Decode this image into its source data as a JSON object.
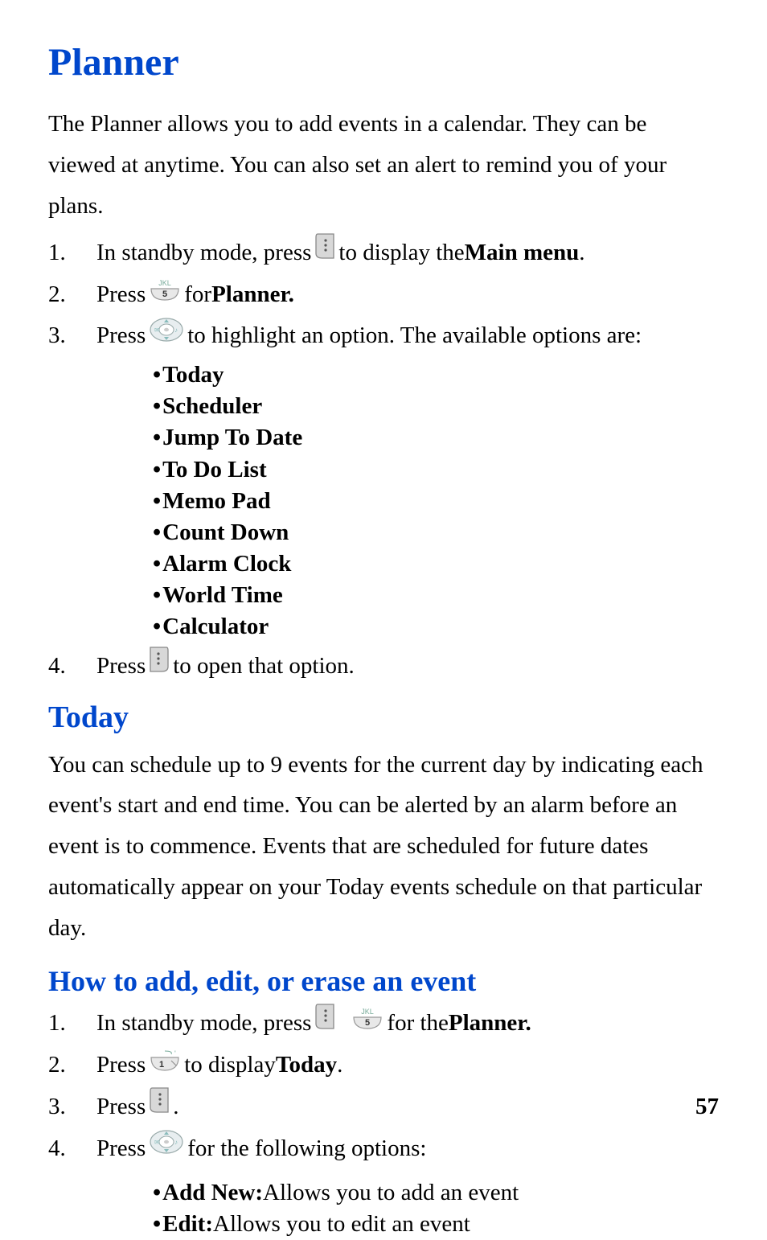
{
  "title": "Planner",
  "intro": "The Planner allows you to add events in a calendar. They can be viewed at anytime. You can also set an alert to remind you of your plans.",
  "steps1": {
    "s1a": "In standby mode, press ",
    "s1b": "  to display the ",
    "s1c": "Main menu",
    "s1d": ".",
    "s2a": "Press  ",
    "s2b": "  for ",
    "s2c": "Planner.",
    "s3a": "Press ",
    "s3b": " to highlight an option. The available options are:",
    "s4a": "Press  ",
    "s4b": "  to open that option."
  },
  "nums": {
    "n1": "1.",
    "n2": "2.",
    "n3": "3.",
    "n4": "4."
  },
  "options": [
    "Today",
    "Scheduler",
    "Jump To Date",
    "To Do List",
    "Memo Pad",
    "Count Down",
    "Alarm Clock",
    "World Time",
    "Calculator"
  ],
  "today_heading": "Today",
  "today_para": "You can schedule up to 9 events for the current day by indicating each event's start and end time. You can be alerted by an alarm before an event is to commence. Events that are scheduled for future dates automatically appear on your Today events schedule on that particular day.",
  "howto_heading": "How to add, edit, or erase an event",
  "steps2": {
    "s1a": "In standby mode, press ",
    "s1b": "  for the ",
    "s1c": "Planner.",
    "s2a": "Press ",
    "s2b": " to display ",
    "s2c": "Today",
    "s2d": ".",
    "s3a": "Press ",
    "s3b": "  .",
    "s4a": "Press ",
    "s4b": " for the following options:"
  },
  "options2": [
    {
      "label": "Add New:",
      "desc": " Allows you to add an event"
    },
    {
      "label": "Edit:",
      "desc": " Allows you to edit an event"
    }
  ],
  "page": "57",
  "icons": {
    "menu": "menu-key-icon",
    "key5": "key-5-icon",
    "nav": "nav-pad-icon",
    "ok": "ok-key-icon",
    "key1": "key-1-icon"
  }
}
